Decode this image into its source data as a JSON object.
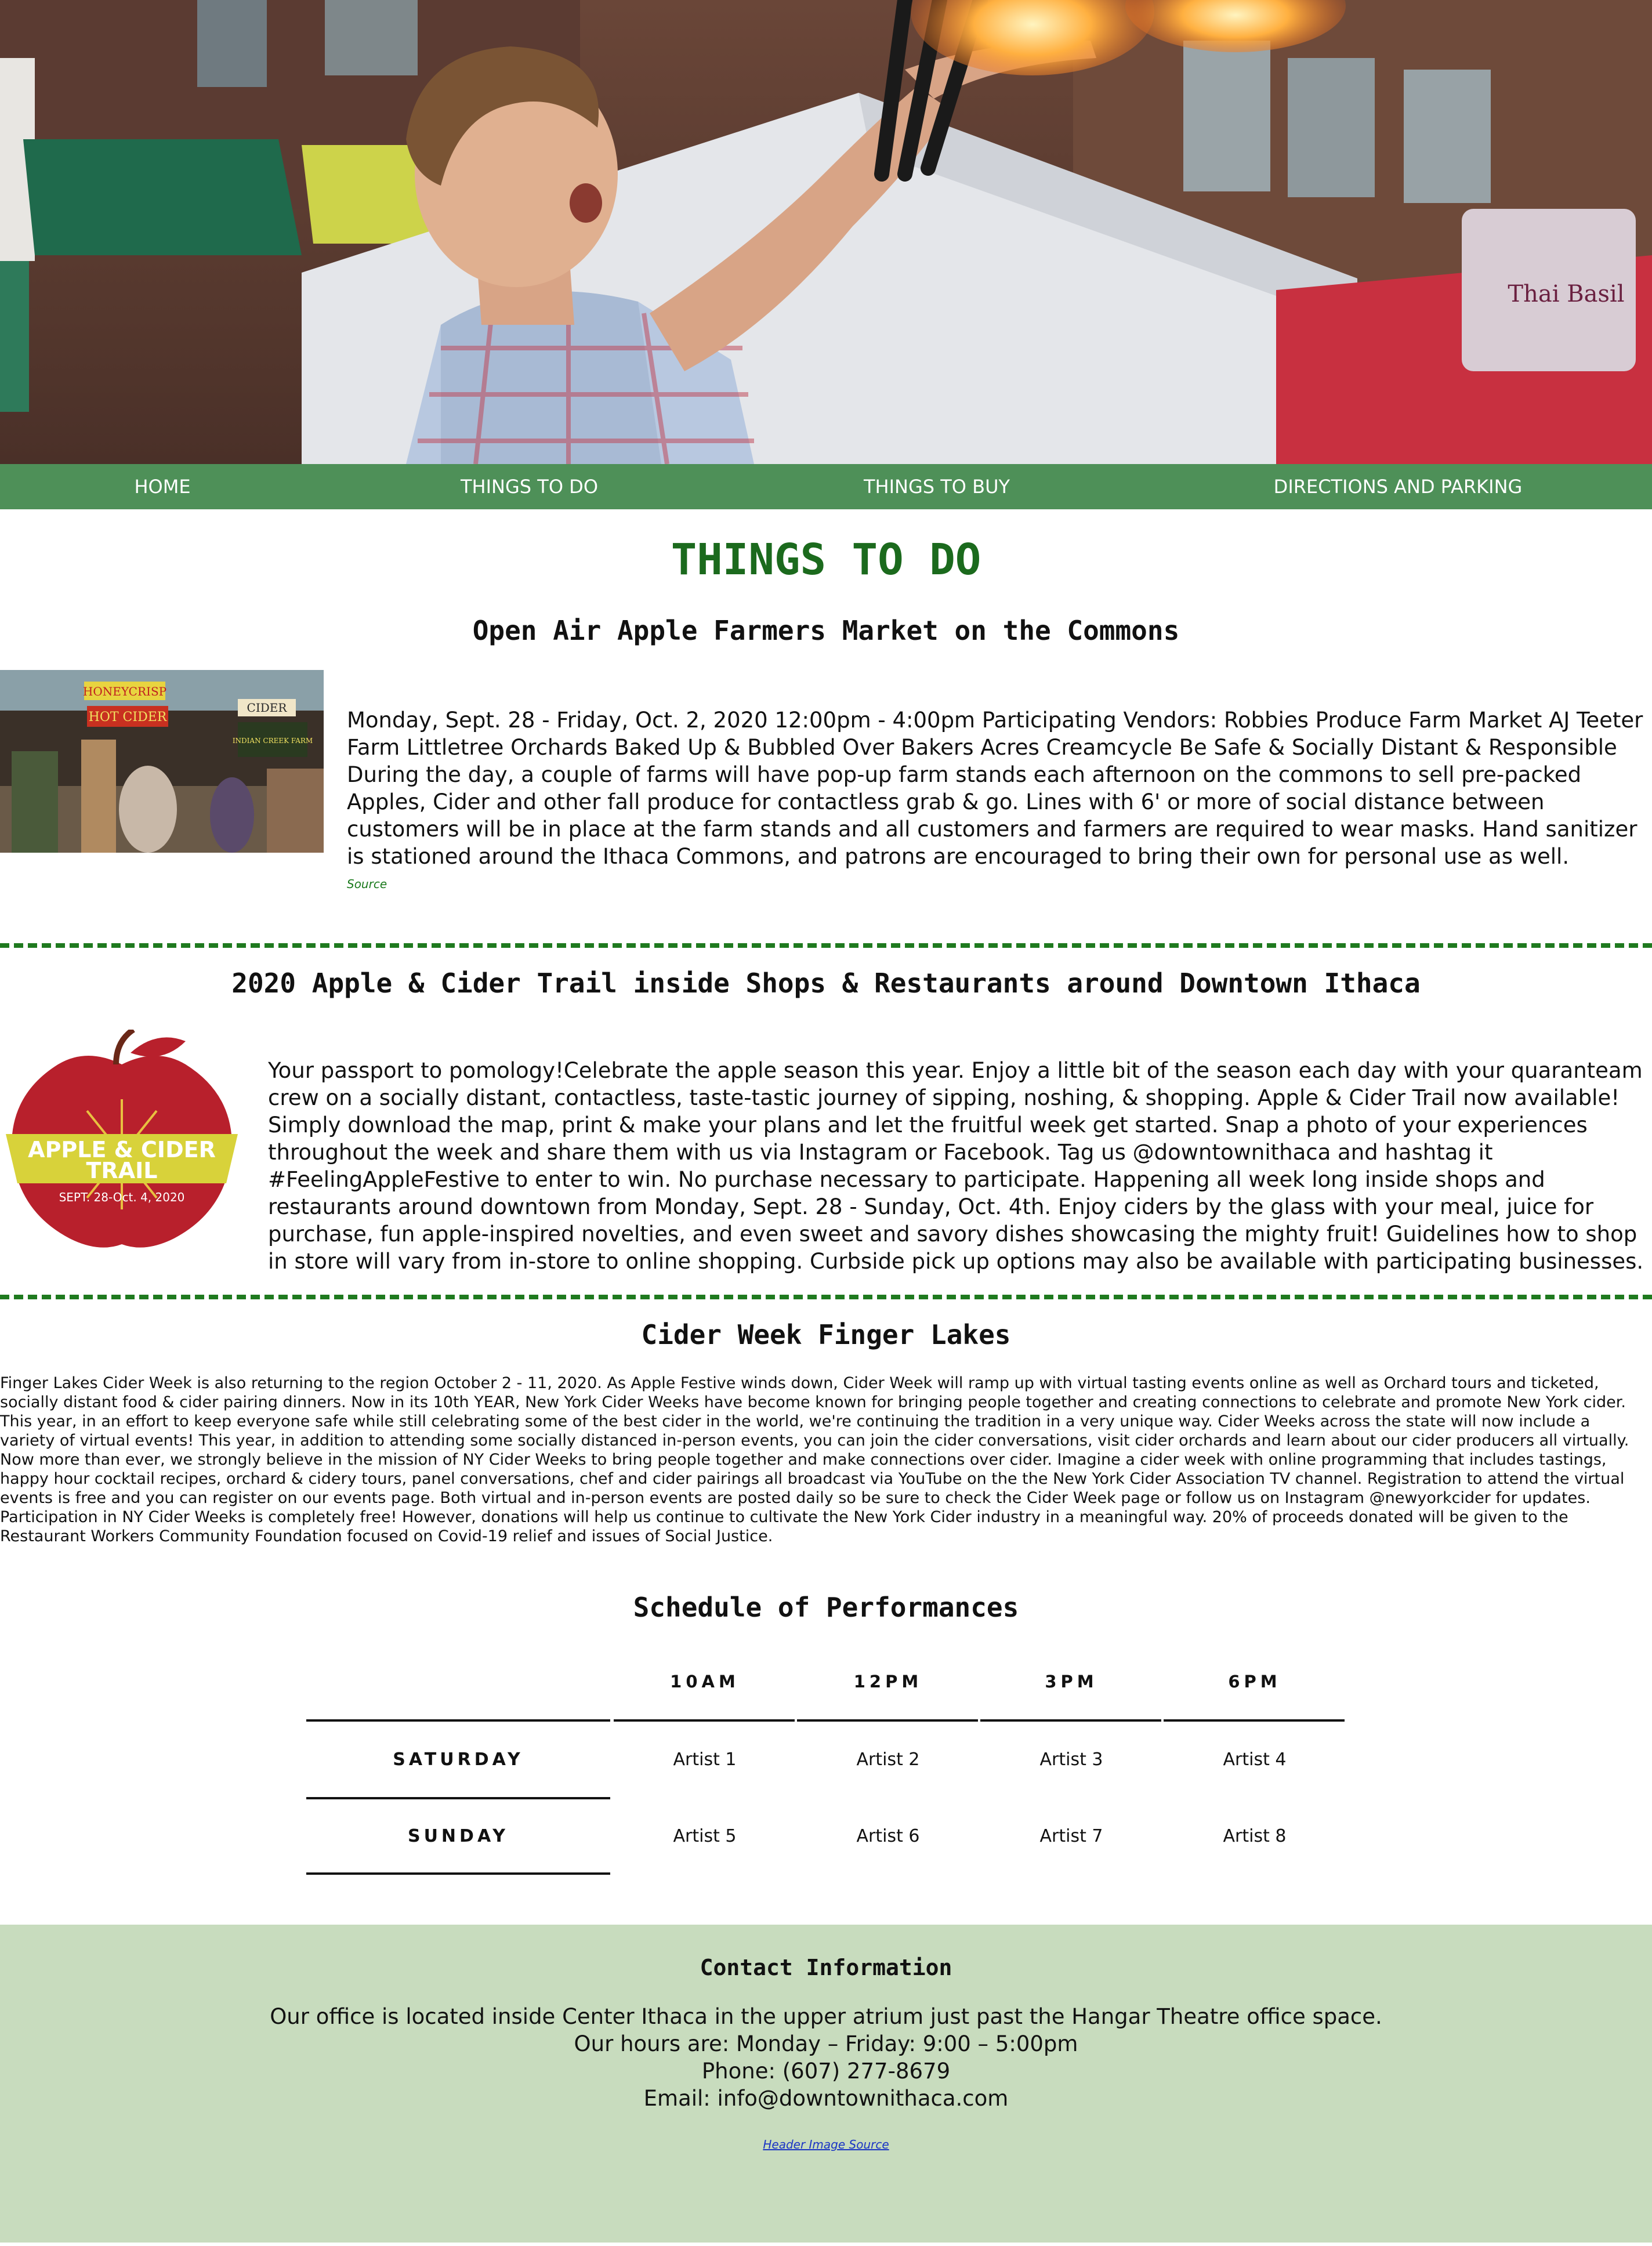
{
  "nav": {
    "items": [
      "HOME",
      "THINGS TO DO",
      "THINGS TO BUY",
      "DIRECTIONS AND PARKING"
    ]
  },
  "hero": {
    "sign_text": "Thai Basil"
  },
  "page": {
    "title": "THINGS TO DO"
  },
  "sections": {
    "market": {
      "heading": "Open Air Apple Farmers Market on the Commons",
      "image_signs": [
        "HONEYCRISP",
        "HOT CIDER",
        "CIDER",
        "INDIAN CREEK FARM"
      ],
      "body": "Monday, Sept. 28 - Friday, Oct. 2, 2020 12:00pm - 4:00pm Participating Vendors: Robbies Produce Farm Market AJ Teeter Farm Littletree Orchards Baked Up & Bubbled Over Bakers Acres Creamcycle Be Safe & Socially Distant & Responsible During the day, a couple of farms will have pop-up farm stands each afternoon on the commons to sell pre-packed Apples, Cider and other fall produce for contactless grab & go. Lines with 6' or more of social distance between customers will be in place at the farm stands and all customers and farmers are required to wear masks. Hand sanitizer is stationed around the Ithaca Commons, and patrons are encouraged to bring their own for personal use as well.",
      "source_label": "Source"
    },
    "trail": {
      "heading": "2020 Apple & Cider Trail inside Shops & Restaurants around Downtown Ithaca",
      "logo_line1": "APPLE & CIDER",
      "logo_line2": "TRAIL",
      "logo_dates": "SEPT. 28-Oct. 4, 2020",
      "body": "Your passport to pomology!Celebrate the apple season this year. Enjoy a little bit of the season each day with your quaranteam crew on a socially distant, contactless, taste-tastic journey of sipping, noshing, & shopping. Apple & Cider Trail now available! Simply download the map, print & make your plans and let the fruitful week get started. Snap a photo of your experiences throughout the week and share them with us via Instagram or Facebook. Tag us @downtownithaca and hashtag it #FeelingAppleFestive to enter to win. No purchase necessary to participate. Happening all week long inside shops and restaurants around downtown from Monday, Sept. 28 - Sunday, Oct. 4th. Enjoy ciders by the glass with your meal, juice for purchase, fun apple-inspired novelties, and even sweet and savory dishes showcasing the mighty fruit! Guidelines how to shop in store will vary from in-store to online shopping. Curbside pick up options may also be available with participating businesses."
    },
    "cider_week": {
      "heading": "Cider Week Finger Lakes",
      "body": "Finger Lakes Cider Week is also returning to the region October 2 - 11, 2020. As Apple Festive winds down, Cider Week will ramp up with virtual tasting events online as well as Orchard tours and ticketed, socially distant food & cider pairing dinners. Now in its 10th YEAR, New York Cider Weeks have become known for bringing people together and creating connections to celebrate and promote New York cider. This year, in an effort to keep everyone safe while still celebrating some of the best cider in the world, we're continuing the tradition in a very unique way. Cider Weeks across the state will now include a variety of virtual events! This year, in addition to attending some socially distanced in-person events, you can join the cider conversations, visit cider orchards and learn about our cider producers all virtually. Now more than ever, we strongly believe in the mission of NY Cider Weeks to bring people together and make connections over cider. Imagine a cider week with online programming that includes tastings, happy hour cocktail recipes, orchard & cidery tours, panel conversations, chef and cider pairings all broadcast via YouTube on the the New York Cider Association TV channel. Registration to attend the virtual events is free and you can register on our events page. Both virtual and in-person events are posted daily so be sure to check the Cider Week page or follow us on Instagram @newyorkcider for updates. Participation in NY Cider Weeks is completely free! However, donations will help us continue to cultivate the New York Cider industry in a meaningful way. 20% of proceeds donated will be given to the Restaurant Workers Community Foundation focused on Covid-19 relief and issues of Social Justice."
    },
    "schedule": {
      "heading": "Schedule of Performances",
      "times": [
        "10AM",
        "12PM",
        "3PM",
        "6PM"
      ],
      "rows": [
        {
          "day": "SATURDAY",
          "artists": [
            "Artist 1",
            "Artist 2",
            "Artist 3",
            "Artist 4"
          ]
        },
        {
          "day": "SUNDAY",
          "artists": [
            "Artist 5",
            "Artist 6",
            "Artist 7",
            "Artist 8"
          ]
        }
      ]
    }
  },
  "footer": {
    "heading": "Contact Information",
    "lines": [
      "Our office is located inside Center Ithaca in the upper atrium just past the Hangar Theatre office space.",
      "Our hours are: Monday – Friday: 9:00 – 5:00pm",
      "Phone: (607) 277-8679",
      "Email: info@downtownithaca.com"
    ],
    "header_source_label": "Header Image Source"
  },
  "colors": {
    "nav_bg": "#4e9058",
    "title_green": "#1b6a1d",
    "divider_green": "#1f7a1f",
    "footer_bg": "#c8dcbe",
    "apple_red": "#b8202c",
    "banner_yellow": "#d8d23a"
  }
}
